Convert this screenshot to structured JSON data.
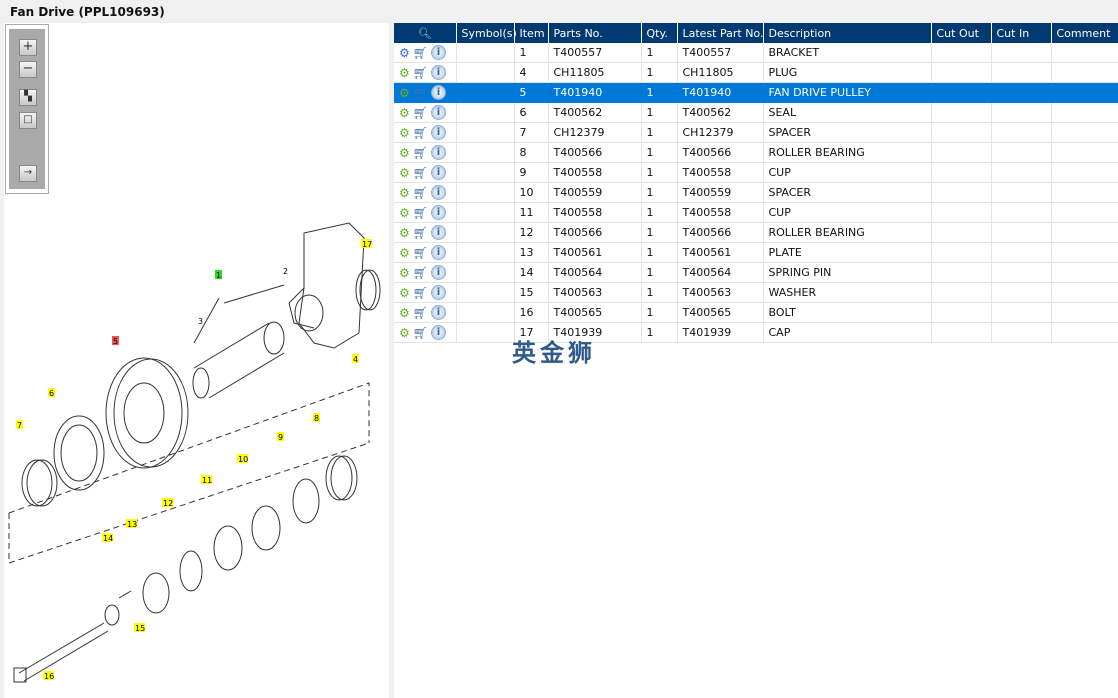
{
  "title": "Fan Drive (PPL109693)",
  "toolbar": {
    "zoom_in": "zoom-in",
    "zoom_out": "zoom-out",
    "fit": "fit",
    "actual": "actual-size",
    "export": "export"
  },
  "table": {
    "headers": [
      "Symbol(s)",
      "Item",
      "Parts No.",
      "Qty.",
      "Latest Part No.",
      "Description",
      "Cut Out",
      "Cut In",
      "Comment"
    ],
    "rows": [
      {
        "item": "1",
        "part": "T400557",
        "qty": "1",
        "latest": "T400557",
        "desc": "BRACKET",
        "assembly": true
      },
      {
        "item": "4",
        "part": "CH11805",
        "qty": "1",
        "latest": "CH11805",
        "desc": "PLUG"
      },
      {
        "item": "5",
        "part": "T401940",
        "qty": "1",
        "latest": "T401940",
        "desc": "FAN DRIVE PULLEY",
        "selected": true
      },
      {
        "item": "6",
        "part": "T400562",
        "qty": "1",
        "latest": "T400562",
        "desc": "SEAL"
      },
      {
        "item": "7",
        "part": "CH12379",
        "qty": "1",
        "latest": "CH12379",
        "desc": "SPACER"
      },
      {
        "item": "8",
        "part": "T400566",
        "qty": "1",
        "latest": "T400566",
        "desc": "ROLLER BEARING"
      },
      {
        "item": "9",
        "part": "T400558",
        "qty": "1",
        "latest": "T400558",
        "desc": "CUP"
      },
      {
        "item": "10",
        "part": "T400559",
        "qty": "1",
        "latest": "T400559",
        "desc": "SPACER"
      },
      {
        "item": "11",
        "part": "T400558",
        "qty": "1",
        "latest": "T400558",
        "desc": "CUP"
      },
      {
        "item": "12",
        "part": "T400566",
        "qty": "1",
        "latest": "T400566",
        "desc": "ROLLER BEARING"
      },
      {
        "item": "13",
        "part": "T400561",
        "qty": "1",
        "latest": "T400561",
        "desc": "PLATE"
      },
      {
        "item": "14",
        "part": "T400564",
        "qty": "1",
        "latest": "T400564",
        "desc": "SPRING PIN"
      },
      {
        "item": "15",
        "part": "T400563",
        "qty": "1",
        "latest": "T400563",
        "desc": "WASHER"
      },
      {
        "item": "16",
        "part": "T400565",
        "qty": "1",
        "latest": "T400565",
        "desc": "BOLT"
      },
      {
        "item": "17",
        "part": "T401939",
        "qty": "1",
        "latest": "T401939",
        "desc": "CAP"
      }
    ]
  },
  "callouts": [
    {
      "n": "1",
      "c": "#22dd22"
    },
    {
      "n": "2",
      "c": ""
    },
    {
      "n": "3",
      "c": ""
    },
    {
      "n": "4",
      "c": "#ffff00"
    },
    {
      "n": "5",
      "c": "#ee5555"
    },
    {
      "n": "6",
      "c": "#ffff00"
    },
    {
      "n": "7",
      "c": "#ffff00"
    },
    {
      "n": "8",
      "c": "#ffff00"
    },
    {
      "n": "9",
      "c": "#ffff00"
    },
    {
      "n": "10",
      "c": "#ffff00"
    },
    {
      "n": "11",
      "c": "#ffff00"
    },
    {
      "n": "12",
      "c": "#ffff00"
    },
    {
      "n": "13",
      "c": "#ffff00"
    },
    {
      "n": "14",
      "c": "#ffff00"
    },
    {
      "n": "15",
      "c": "#ffff00"
    },
    {
      "n": "16",
      "c": "#ffff00"
    },
    {
      "n": "17",
      "c": "#ffff00"
    }
  ],
  "watermark": "英金狮",
  "colors": {
    "header": "#003a70",
    "selected": "#0078d7"
  }
}
